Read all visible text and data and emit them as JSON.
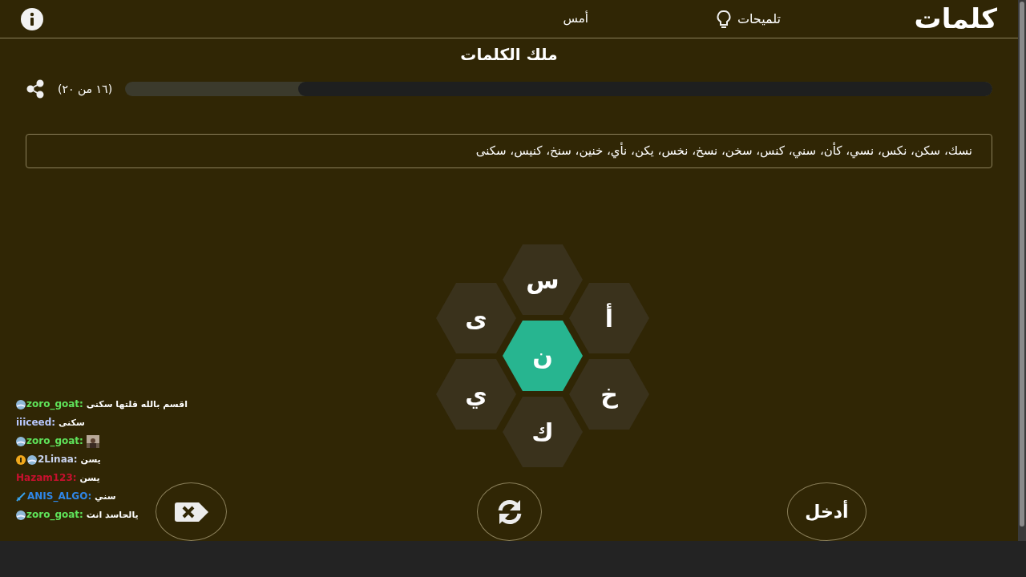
{
  "header": {
    "logo": "كلمات",
    "hints": "تلميحات",
    "yesterday": "أمس"
  },
  "rank": "ملك الكلمات",
  "progress": {
    "count": "(١٦ من ٢٠)",
    "level": 0.8
  },
  "found_words": "نسك، سكن، نكس، نسي، كأن، سني، كنس، سخن، نسخ، نخس، يكن، نأي، خنين، سنخ، كنيس، سكنى",
  "letters": [
    {
      "letter": "س",
      "kind": "outer"
    },
    {
      "letter": "أ",
      "kind": "outer"
    },
    {
      "letter": "ى",
      "kind": "outer"
    },
    {
      "letter": "ن",
      "kind": "center"
    },
    {
      "letter": "خ",
      "kind": "outer"
    },
    {
      "letter": "ي",
      "kind": "outer"
    },
    {
      "letter": "ك",
      "kind": "outer"
    }
  ],
  "buttons": {
    "enter": "أدخل"
  },
  "chat": [
    {
      "user": "zoro_goat:",
      "color": "#5fe35a",
      "badges": [
        {
          "kind": "globe"
        }
      ],
      "kind": "text",
      "message": "اقسم بالله قلتها سكنى"
    },
    {
      "user": "iiiceed:",
      "color": "#b9c8ff",
      "kind": "text",
      "message": "سكنى"
    },
    {
      "user": "zoro_goat:",
      "color": "#5fe35a",
      "badges": [
        {
          "kind": "globe"
        }
      ],
      "kind": "emote"
    },
    {
      "user": "2Linaa:",
      "color": "#c9d3ee",
      "badges": [
        {
          "kind": "one"
        },
        {
          "kind": "globe"
        }
      ],
      "kind": "text",
      "message": "يسن"
    },
    {
      "user": "Hazam123:",
      "color": "#c8102e",
      "kind": "text",
      "message": "يسن"
    },
    {
      "user": "ANIS_ALGO:",
      "color": "#2f86e6",
      "badges": [
        {
          "kind": "sword"
        }
      ],
      "kind": "text",
      "message": "سني"
    },
    {
      "user": "zoro_goat:",
      "color": "#5fe35a",
      "badges": [
        {
          "kind": "globe"
        }
      ],
      "kind": "text",
      "message": "يالحاسد انت"
    }
  ]
}
